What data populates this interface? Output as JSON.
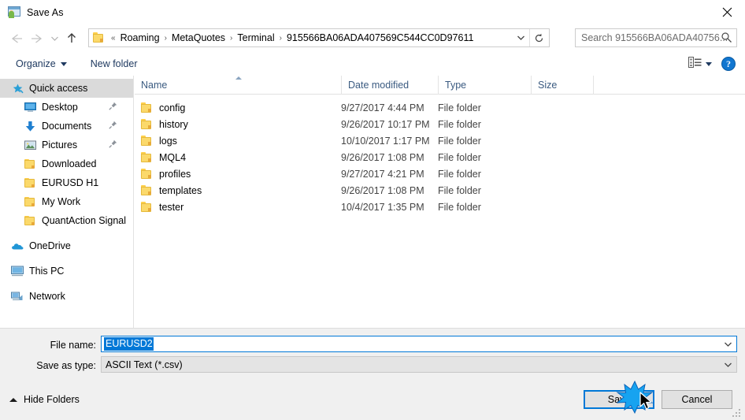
{
  "window": {
    "title": "Save As",
    "app_icon": "save-as-app-icon",
    "close_icon": "close-icon"
  },
  "nav": {
    "back_icon": "back-arrow-icon",
    "forward_icon": "forward-arrow-icon",
    "recent_icon": "recent-locations-chevron-icon",
    "up_icon": "up-arrow-icon",
    "address": {
      "folder_icon": "folder-icon",
      "prefix": "«",
      "segments": [
        "Roaming",
        "MetaQuotes",
        "Terminal",
        "915566BA06ADA407569C544CC0D97611"
      ],
      "separator": "›",
      "dropdown_icon": "chevron-down-icon",
      "refresh_icon": "refresh-icon"
    },
    "search": {
      "placeholder": "Search 915566BA06ADA40756...",
      "value": "",
      "icon": "search-icon"
    }
  },
  "toolbar": {
    "organize_label": "Organize",
    "organize_caret_icon": "caret-down-icon",
    "new_folder_label": "New folder",
    "view_icon": "view-options-icon",
    "view_caret_icon": "caret-down-icon",
    "help_label": "?",
    "help_icon": "help-icon"
  },
  "sidebar": {
    "items": [
      {
        "label": "Quick access",
        "icon": "star-pin-icon",
        "level": 0,
        "selected": true,
        "pinned": false
      },
      {
        "label": "Desktop",
        "icon": "desktop-icon",
        "level": 1,
        "selected": false,
        "pinned": true
      },
      {
        "label": "Documents",
        "icon": "documents-download-icon",
        "level": 1,
        "selected": false,
        "pinned": true
      },
      {
        "label": "Pictures",
        "icon": "pictures-icon",
        "level": 1,
        "selected": false,
        "pinned": true
      },
      {
        "label": "Downloaded",
        "icon": "folder-icon",
        "level": 1,
        "selected": false,
        "pinned": false
      },
      {
        "label": "EURUSD H1",
        "icon": "folder-icon",
        "level": 1,
        "selected": false,
        "pinned": false
      },
      {
        "label": "My Work",
        "icon": "folder-icon",
        "level": 1,
        "selected": false,
        "pinned": false
      },
      {
        "label": "QuantAction Signal",
        "icon": "folder-icon",
        "level": 1,
        "selected": false,
        "pinned": false
      },
      {
        "label": "OneDrive",
        "icon": "onedrive-cloud-icon",
        "level": 0,
        "selected": false,
        "pinned": false,
        "gap_before": true
      },
      {
        "label": "This PC",
        "icon": "this-pc-icon",
        "level": 0,
        "selected": false,
        "pinned": false,
        "gap_before": true
      },
      {
        "label": "Network",
        "icon": "network-icon",
        "level": 0,
        "selected": false,
        "pinned": false,
        "gap_before": true
      }
    ]
  },
  "file_list": {
    "columns": [
      "Name",
      "Date modified",
      "Type",
      "Size"
    ],
    "sort_column": "Name",
    "sort_direction": "ascending",
    "rows": [
      {
        "name": "config",
        "date_modified": "9/27/2017 4:44 PM",
        "type": "File folder",
        "size": "",
        "icon": "folder-icon"
      },
      {
        "name": "history",
        "date_modified": "9/26/2017 10:17 PM",
        "type": "File folder",
        "size": "",
        "icon": "folder-icon"
      },
      {
        "name": "logs",
        "date_modified": "10/10/2017 1:17 PM",
        "type": "File folder",
        "size": "",
        "icon": "folder-icon"
      },
      {
        "name": "MQL4",
        "date_modified": "9/26/2017 1:08 PM",
        "type": "File folder",
        "size": "",
        "icon": "folder-icon"
      },
      {
        "name": "profiles",
        "date_modified": "9/27/2017 4:21 PM",
        "type": "File folder",
        "size": "",
        "icon": "folder-icon"
      },
      {
        "name": "templates",
        "date_modified": "9/26/2017 1:08 PM",
        "type": "File folder",
        "size": "",
        "icon": "folder-icon"
      },
      {
        "name": "tester",
        "date_modified": "10/4/2017 1:35 PM",
        "type": "File folder",
        "size": "",
        "icon": "folder-icon"
      }
    ]
  },
  "form": {
    "file_name_label": "File name:",
    "file_name_value": "EURUSD2",
    "file_name_selected": true,
    "save_as_type_label": "Save as type:",
    "save_as_type_value": "ASCII Text (*.csv)",
    "dropdown_icon": "chevron-down-icon"
  },
  "footer": {
    "hide_folders_label": "Hide Folders",
    "hide_folders_icon": "chevron-up-icon",
    "save_label": "Save",
    "cancel_label": "Cancel",
    "resize_grip_icon": "resize-grip-icon"
  },
  "pointer": {
    "cursor_icon": "mouse-arrow-cursor",
    "click_effect_icon": "click-burst-icon"
  },
  "colors": {
    "accent": "#0078d7",
    "selection": "#0078d7",
    "sidebar_selected": "#dadada",
    "folder_yellow": "#fbd96b",
    "dialog_bg": "#f0f0f0",
    "header_text": "#3a5a80",
    "toolbar_text": "#1f3a60"
  }
}
